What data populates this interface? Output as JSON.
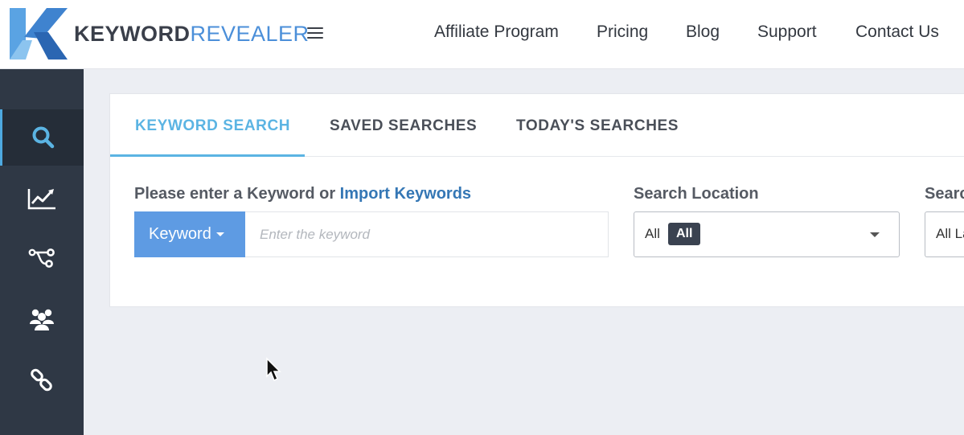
{
  "brand": {
    "part1": "KEYWORD",
    "part2": "REVEALER",
    "logo_icon": "keywordrevealer-k-logo"
  },
  "nav": {
    "menu_icon": "hamburger-menu-icon",
    "items": [
      "Affiliate Program",
      "Pricing",
      "Blog",
      "Support",
      "Contact Us"
    ]
  },
  "sidebar": {
    "items": [
      {
        "icon": "search-icon",
        "active": true
      },
      {
        "icon": "line-chart-icon",
        "active": false
      },
      {
        "icon": "branch-nodes-icon",
        "active": false
      },
      {
        "icon": "users-group-icon",
        "active": false
      },
      {
        "icon": "chain-link-icon",
        "active": false
      }
    ]
  },
  "tabs": [
    {
      "label": "KEYWORD SEARCH",
      "active": true
    },
    {
      "label": "SAVED SEARCHES",
      "active": false
    },
    {
      "label": "TODAY'S SEARCHES",
      "active": false
    }
  ],
  "form": {
    "keyword_label": "Please enter a Keyword or ",
    "import_link": "Import Keywords",
    "keyword_type_button": "Keyword",
    "keyword_placeholder": "Enter the keyword",
    "keyword_value": "",
    "location_label": "Search Location",
    "location_text": "All",
    "location_badge": "All",
    "language_label": "Search Language",
    "language_text": "All Languages"
  },
  "colors": {
    "sidebar_bg": "#2f3845",
    "accent_blue": "#5bb4e3",
    "button_blue": "#5e9be3",
    "link_blue": "#3577b5",
    "page_bg": "#eceef3"
  }
}
